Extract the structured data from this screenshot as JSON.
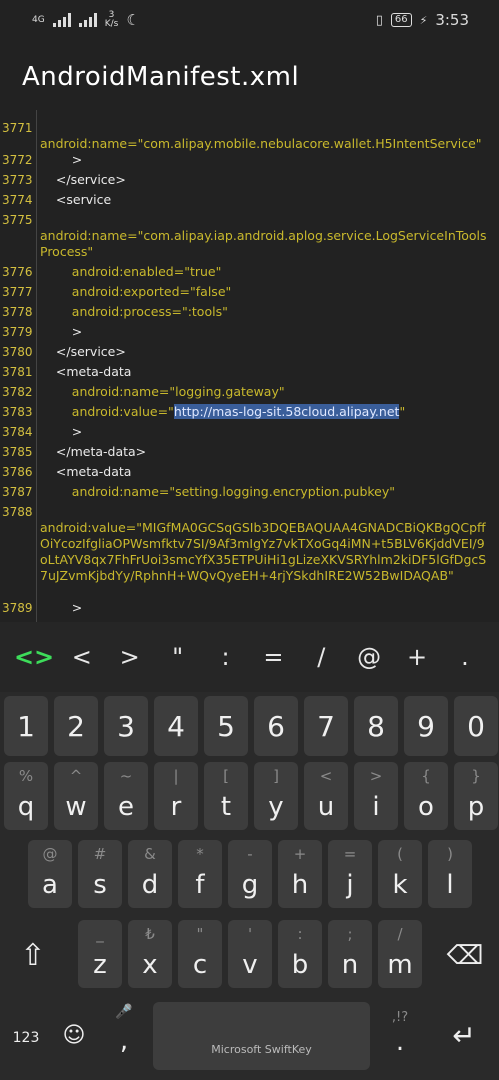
{
  "status_bar": {
    "network_type": "4G",
    "speed_value": "3",
    "speed_unit": "K/s",
    "battery": "66",
    "time": "3:53"
  },
  "title": "AndroidManifest.xml",
  "code_lines": [
    {
      "ln": "3771",
      "text": "",
      "cont": "android:name=\"com.alipay.mobile.nebulacore.wallet.H5IntentService\""
    },
    {
      "ln": "3772",
      "text": "        >"
    },
    {
      "ln": "3773",
      "text": "    </service>"
    },
    {
      "ln": "3774",
      "text": "    <service"
    },
    {
      "ln": "3775",
      "text": "",
      "cont": "android:name=\"com.alipay.iap.android.aplog.service.LogServiceInToolsProcess\""
    },
    {
      "ln": "3776",
      "text": "        android:enabled=\"true\""
    },
    {
      "ln": "3777",
      "text": "        android:exported=\"false\""
    },
    {
      "ln": "3778",
      "text": "        android:process=\":tools\""
    },
    {
      "ln": "3779",
      "text": "        >"
    },
    {
      "ln": "3780",
      "text": "    </service>"
    },
    {
      "ln": "3781",
      "text": "    <meta-data"
    },
    {
      "ln": "3782",
      "text": "        android:name=\"logging.gateway\""
    },
    {
      "ln": "3783",
      "pre": "        android:value=\"",
      "sel": "http://mas-log-sit.58cloud.alipay.net",
      "post": "\""
    },
    {
      "ln": "3784",
      "text": "        >"
    },
    {
      "ln": "3785",
      "text": "    </meta-data>"
    },
    {
      "ln": "3786",
      "text": "    <meta-data"
    },
    {
      "ln": "3787",
      "text": "        android:name=\"setting.logging.encryption.pubkey\""
    },
    {
      "ln": "3788",
      "text": "",
      "cont": "android:value=\"MIGfMA0GCSqGSIb3DQEBAQUAA4GNADCBiQKBgQCpffOiYcozIfgliaOPWsmfktv7SI/9Af3mIgYz7vkTXoGq4iMN+t5BLV6KjddVEI/9oLtAYV8qx7FhFrUoi3smcYfX35ETPUiHi1gLizeXKVSRYhlm2kiDF5lGfDgcS7uJZvmKjbdYy/RphnH+WQvQyeEH+4rjYSkdhIRE2W52BwIDAQAB\""
    },
    {
      "ln": "3789",
      "text": "        >"
    }
  ],
  "toolbar": {
    "code_symbol": "<>",
    "symbols": [
      "<",
      ">",
      "\"",
      ":",
      "=",
      "/",
      "@",
      "+",
      "."
    ]
  },
  "keyboard": {
    "numbers": [
      "1",
      "2",
      "3",
      "4",
      "5",
      "6",
      "7",
      "8",
      "9",
      "0"
    ],
    "row1": [
      {
        "main": "q",
        "hint": "%"
      },
      {
        "main": "w",
        "hint": "^"
      },
      {
        "main": "e",
        "hint": "~"
      },
      {
        "main": "r",
        "hint": "|"
      },
      {
        "main": "t",
        "hint": "["
      },
      {
        "main": "y",
        "hint": "]"
      },
      {
        "main": "u",
        "hint": "<"
      },
      {
        "main": "i",
        "hint": ">"
      },
      {
        "main": "o",
        "hint": "{"
      },
      {
        "main": "p",
        "hint": "}"
      }
    ],
    "row2": [
      {
        "main": "a",
        "hint": "@"
      },
      {
        "main": "s",
        "hint": "#"
      },
      {
        "main": "d",
        "hint": "&"
      },
      {
        "main": "f",
        "hint": "*"
      },
      {
        "main": "g",
        "hint": "-"
      },
      {
        "main": "h",
        "hint": "+"
      },
      {
        "main": "j",
        "hint": "="
      },
      {
        "main": "k",
        "hint": "("
      },
      {
        "main": "l",
        "hint": ")"
      }
    ],
    "row3": [
      {
        "main": "z",
        "hint": "_"
      },
      {
        "main": "x",
        "hint": "₺"
      },
      {
        "main": "c",
        "hint": "\""
      },
      {
        "main": "v",
        "hint": "'"
      },
      {
        "main": "b",
        "hint": ":"
      },
      {
        "main": "n",
        "hint": ";"
      },
      {
        "main": "m",
        "hint": "/"
      }
    ],
    "mode_label": "123",
    "comma_label": ",",
    "space_label": "Microsoft SwiftKey",
    "period_label": ".",
    "punct_hint": ",!?"
  }
}
